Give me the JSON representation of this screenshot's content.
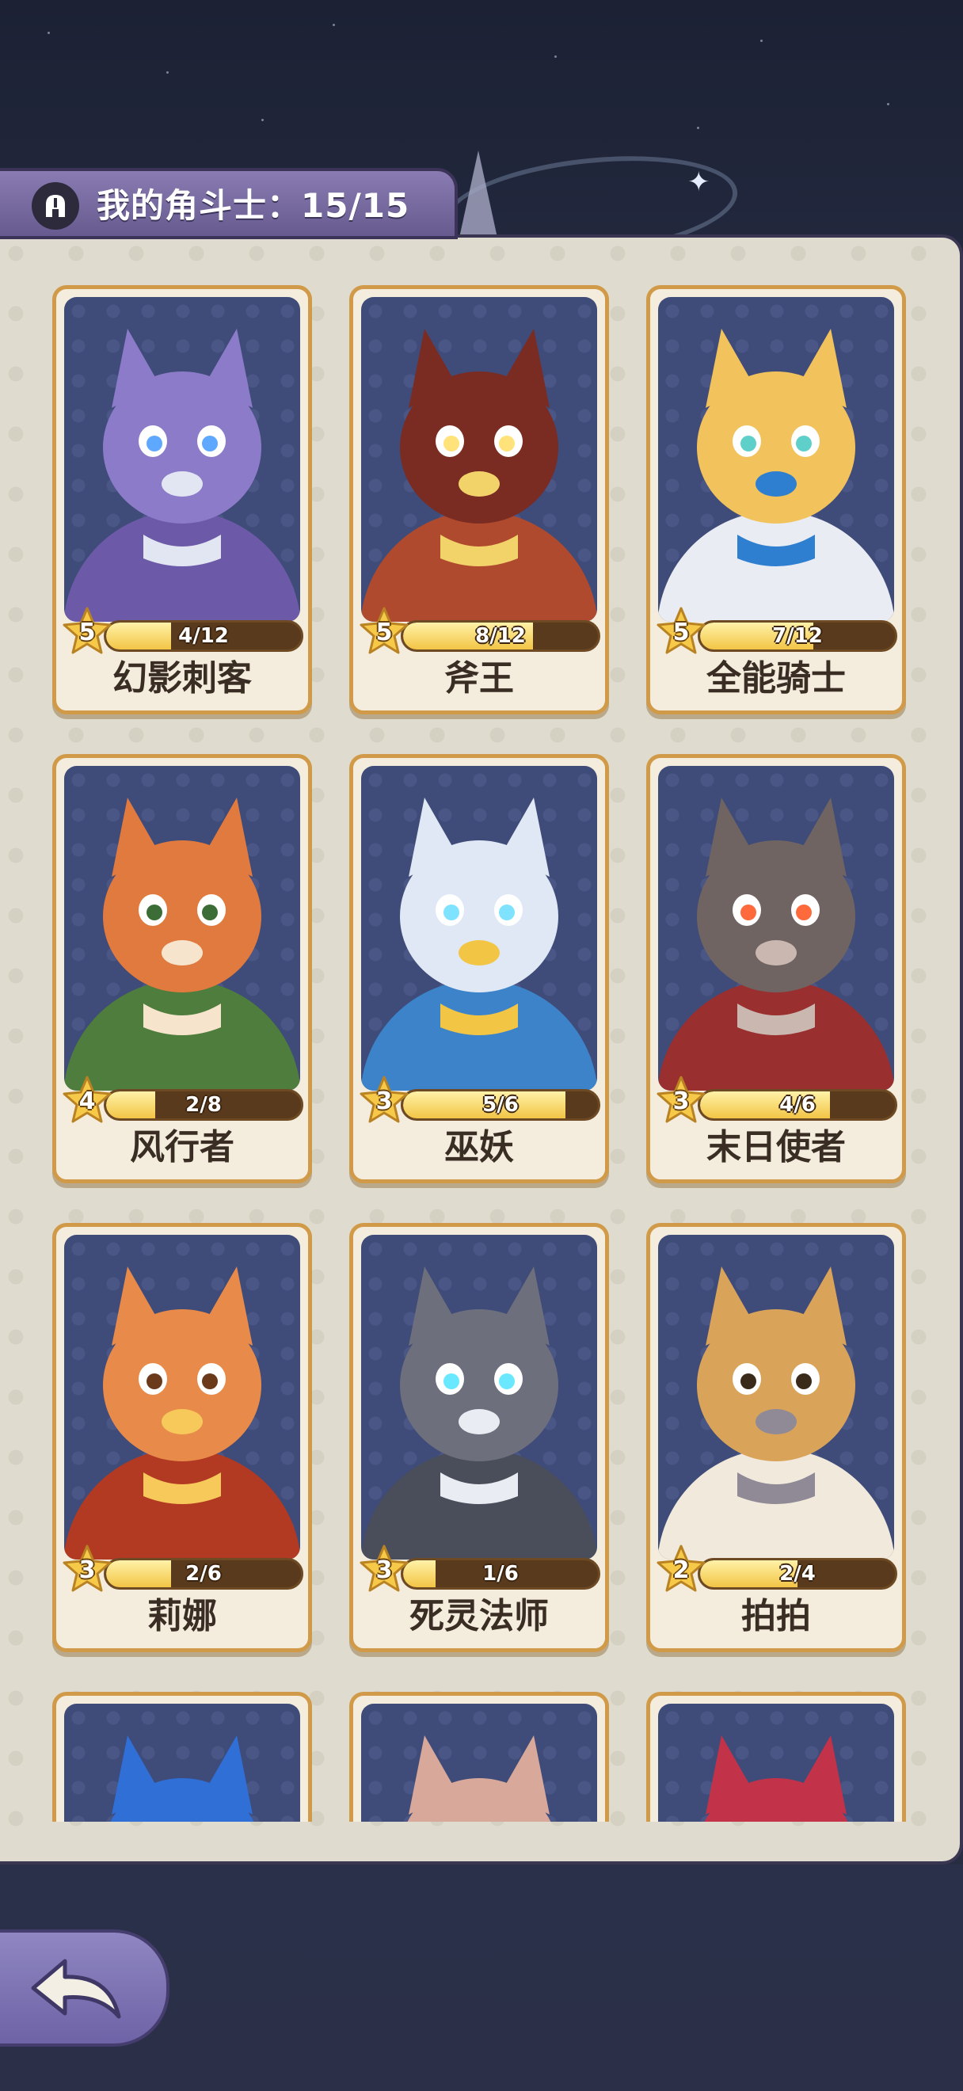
{
  "header": {
    "title": "我的角斗士：15/15"
  },
  "cards": [
    {
      "name": "幻影刺客",
      "level": "5",
      "progress_text": "4/12",
      "progress": 0.333,
      "theme": "purple"
    },
    {
      "name": "斧王",
      "level": "5",
      "progress_text": "8/12",
      "progress": 0.667,
      "theme": "red-bear"
    },
    {
      "name": "全能骑士",
      "level": "5",
      "progress_text": "7/12",
      "progress": 0.583,
      "theme": "golden"
    },
    {
      "name": "风行者",
      "level": "4",
      "progress_text": "2/8",
      "progress": 0.25,
      "theme": "green-fox"
    },
    {
      "name": "巫妖",
      "level": "3",
      "progress_text": "5/6",
      "progress": 0.833,
      "theme": "ice-bunny"
    },
    {
      "name": "末日使者",
      "level": "3",
      "progress_text": "4/6",
      "progress": 0.667,
      "theme": "demon"
    },
    {
      "name": "莉娜",
      "level": "3",
      "progress_text": "2/6",
      "progress": 0.333,
      "theme": "fire-fox"
    },
    {
      "name": "死灵法师",
      "level": "3",
      "progress_text": "1/6",
      "progress": 0.167,
      "theme": "bat"
    },
    {
      "name": "拍拍",
      "level": "2",
      "progress_text": "2/4",
      "progress": 0.5,
      "theme": "bear"
    }
  ],
  "partial_cards": [
    {
      "theme": "blue-hat"
    },
    {
      "theme": "mouse"
    },
    {
      "theme": "horns"
    }
  ],
  "colors": {
    "background": "#262b40",
    "panel": "#dfdccf",
    "card_frame": "#d19a48",
    "progress_fill": "#f2c545",
    "header_tab": "#7a6ea3"
  },
  "icons": {
    "header": "gladiator-helmet-icon",
    "back": "back-arrow-icon",
    "level": "star-badge-icon"
  }
}
